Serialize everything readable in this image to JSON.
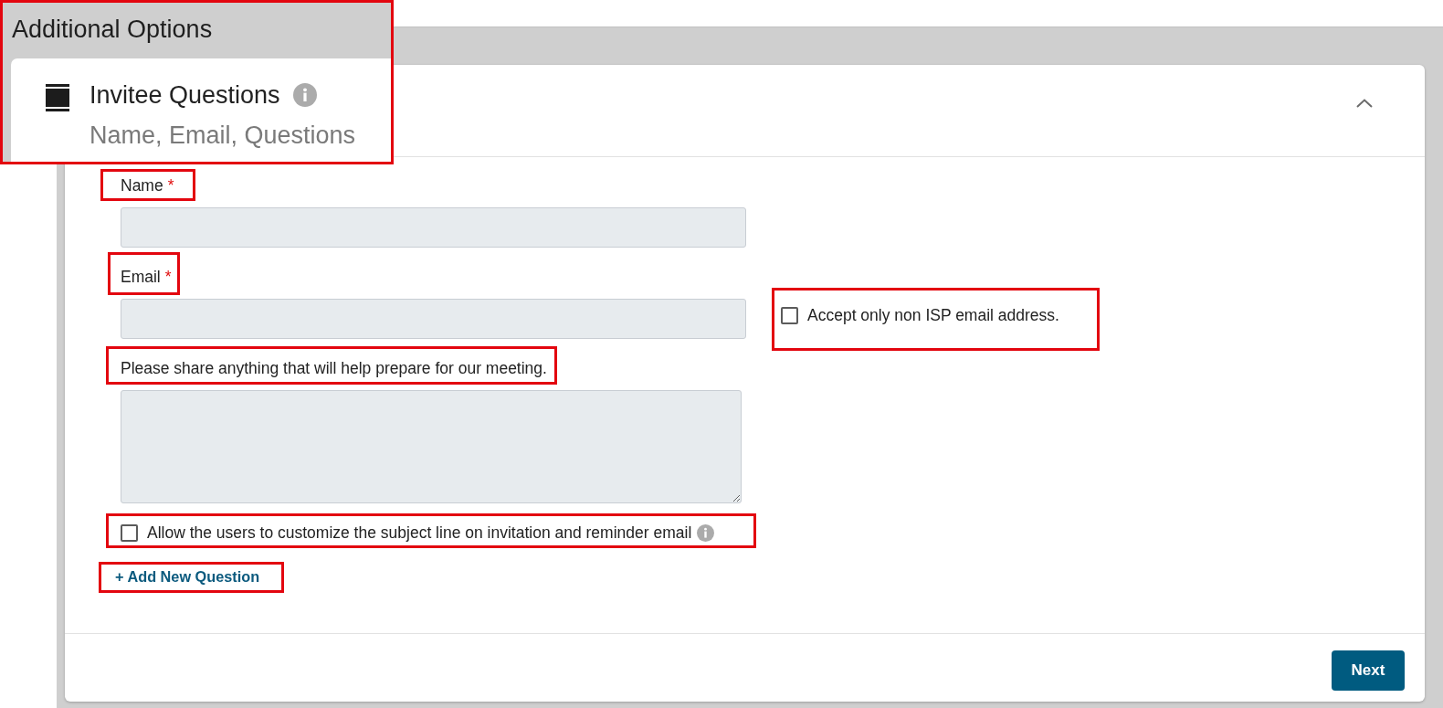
{
  "callout": {
    "page_title": "Additional Options",
    "section_title": "Invitee Questions",
    "section_subtitle": "Name, Email, Questions"
  },
  "card": {
    "expanded": true,
    "fields": [
      {
        "kind": "input",
        "label": "Name",
        "required_mark": "*",
        "highlighted": true
      },
      {
        "kind": "input",
        "label": "Email",
        "required_mark": "*",
        "highlighted": true,
        "option": {
          "label": "Accept only non ISP email address.",
          "checked": false,
          "highlighted": true
        }
      },
      {
        "kind": "textarea",
        "label": "Please share anything that will help prepare for our meeting.",
        "highlighted": true
      }
    ],
    "subject_option": {
      "label": "Allow the users to customize the subject line on invitation and reminder email",
      "checked": false,
      "highlighted": true
    },
    "add_question_link": {
      "label": "+ Add New Question",
      "highlighted": true
    },
    "next_button": {
      "label": "Next"
    }
  }
}
